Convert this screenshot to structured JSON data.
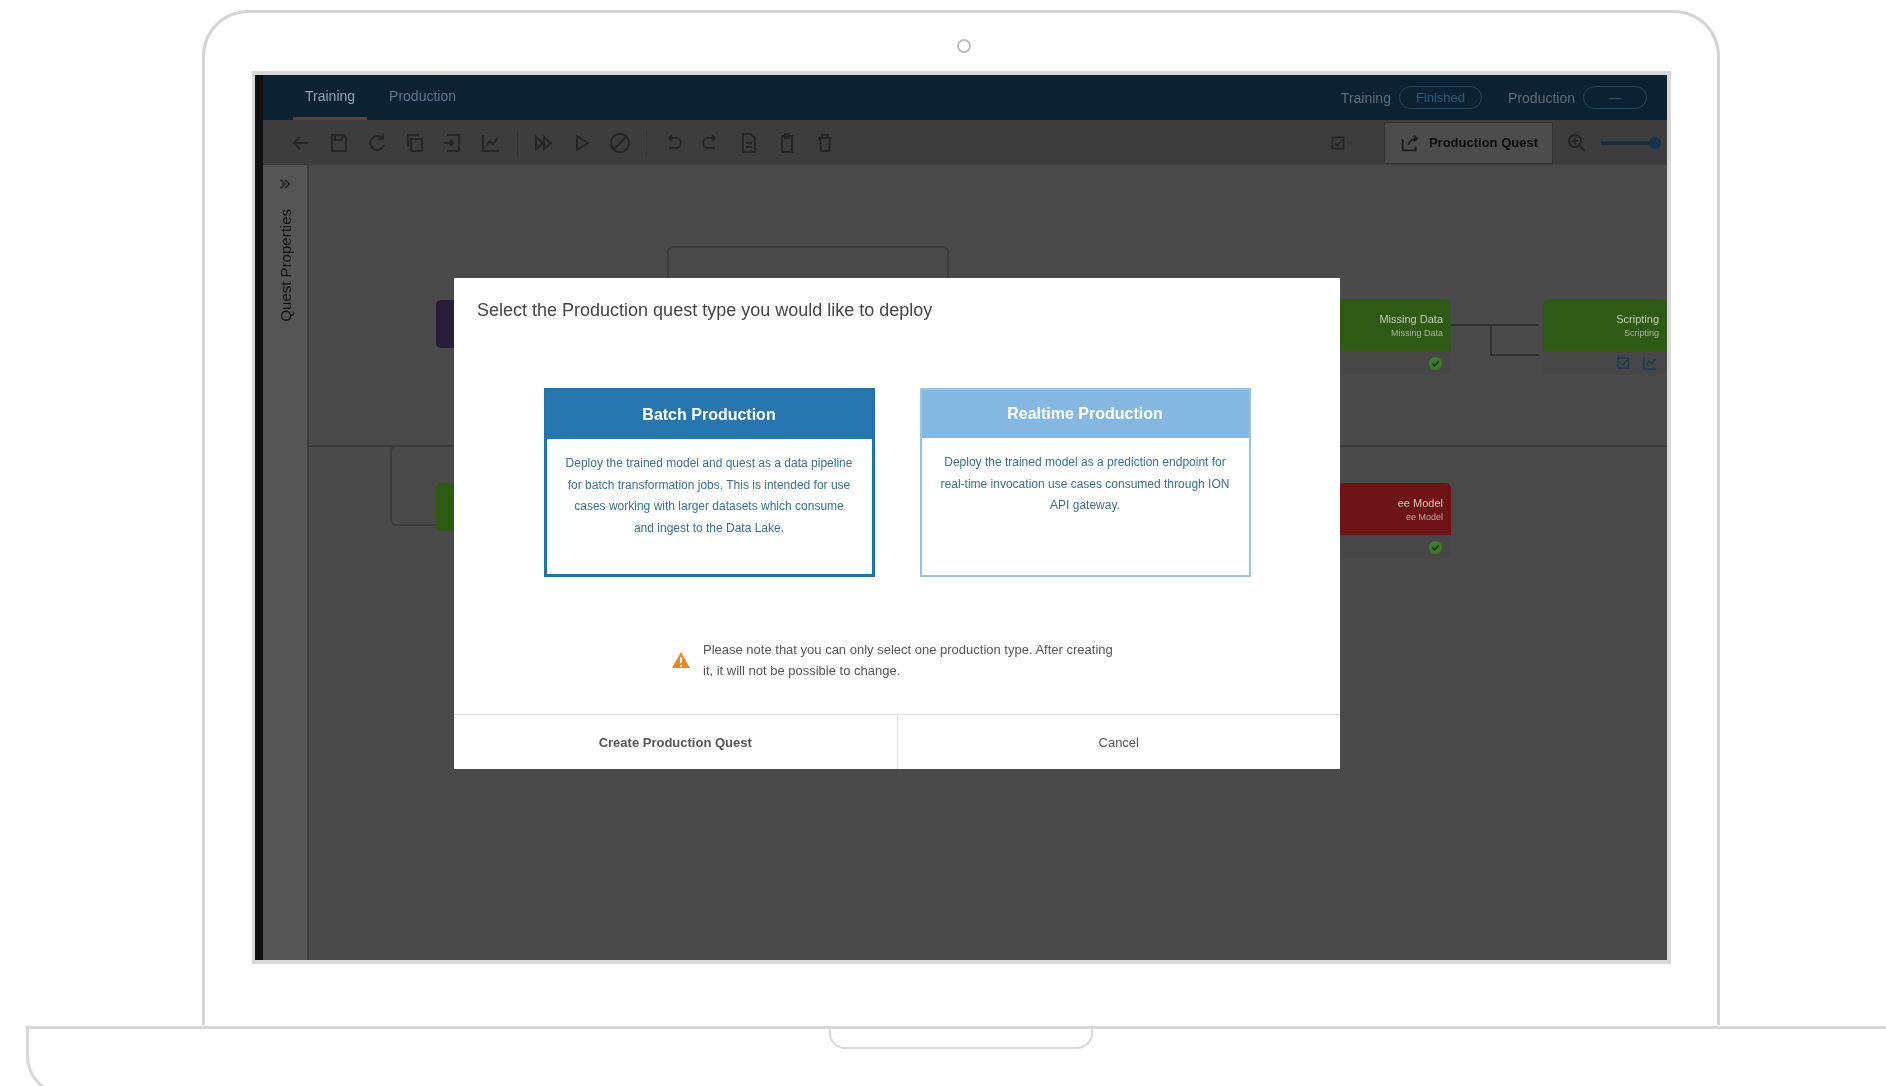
{
  "app_tabs": [
    {
      "label": "Training",
      "selected": true
    },
    {
      "label": "Production",
      "selected": false
    }
  ],
  "status": [
    {
      "label": "Training",
      "value": "Finished"
    },
    {
      "label": "Production",
      "value": "—"
    }
  ],
  "toolbar": {
    "production_button": "Production Quest",
    "zoom_slider": {
      "level": 1
    }
  },
  "sidebar": {
    "title": "Quest Properties"
  },
  "canvas_nodes": [
    {
      "title": "Missing Data",
      "subtitle": "Missing Data",
      "kind": "done",
      "color": "#2f5a16"
    },
    {
      "title": "Scripting",
      "subtitle": "Scripting",
      "kind": "actions",
      "color": "#2f5a16"
    },
    {
      "title": "ee Model",
      "subtitle": "ee Model",
      "kind": "done",
      "color": "#6e1416"
    }
  ],
  "dialog": {
    "title": "Select the Production quest type you would like to deploy",
    "options": [
      {
        "title": "Batch Production",
        "description": "Deploy the trained model and quest as a data pipeline for batch transformation jobs. This is intended for use cases working with larger datasets which consume and ingest to the Data Lake.",
        "selected": true
      },
      {
        "title": "Realtime Production",
        "description": "Deploy the trained model as a prediction endpoint for real-time invocation use cases consumed through ION API gateway.",
        "selected": false
      }
    ],
    "warning": "Please note that you can only select one production type. After creating it, it will not be possible to change.",
    "buttons": [
      "Create Production Quest",
      "Cancel"
    ]
  }
}
